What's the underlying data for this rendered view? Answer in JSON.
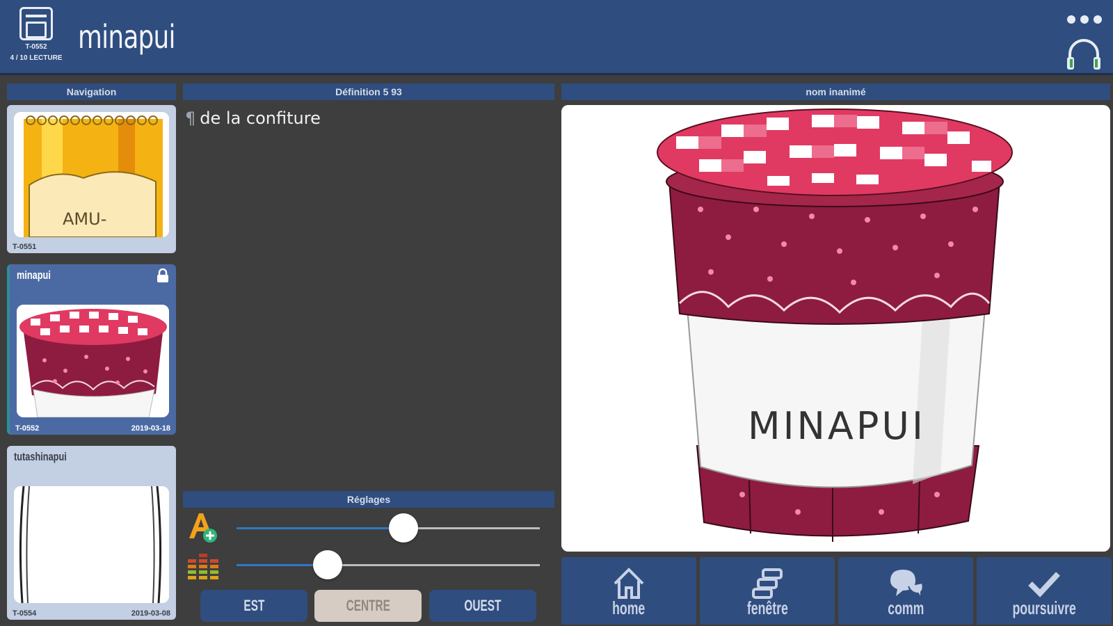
{
  "header": {
    "title": "minapui",
    "badge_line1": "T-0552",
    "badge_line2": "4 / 10  LECTURE",
    "more_icon": "more-horizontal-icon",
    "audio_icon": "headphones-icon"
  },
  "columns": {
    "navigation": "Navigation",
    "definition": "Définition 5 93",
    "image": "nom inanimé",
    "settings": "Réglages"
  },
  "navigation": {
    "items": [
      {
        "title": "",
        "id": "T-0551",
        "date": "",
        "selected": false,
        "image_label": "AMU-"
      },
      {
        "title": "minapui",
        "id": "T-0552",
        "date": "2019-03-18",
        "selected": true,
        "locked": true,
        "image_label": ""
      },
      {
        "title": "tutashinapui",
        "id": "T-0554",
        "date": "2019-03-08",
        "selected": false,
        "image_label": ""
      }
    ]
  },
  "definition": {
    "text": "de la confiture"
  },
  "settings": {
    "font_size_level": 0.55,
    "volume_level": 0.3,
    "alignment_buttons": [
      "EST",
      "CENTRE",
      "OUEST"
    ],
    "active_alignment": "CENTRE"
  },
  "image": {
    "jar_label": "MINAPUI"
  },
  "actions": [
    {
      "label": "home",
      "icon": "home-icon"
    },
    {
      "label": "fenêtre",
      "icon": "windows-stack-icon"
    },
    {
      "label": "comm",
      "icon": "chat-bubbles-icon"
    },
    {
      "label": "poursuivre",
      "icon": "checkmark-icon"
    }
  ],
  "colors": {
    "header_bg": "#2f4d7f",
    "panel_bg": "#3e3e3e",
    "accent_blue": "#2f78c4",
    "jam_red": "#8e1c40"
  }
}
